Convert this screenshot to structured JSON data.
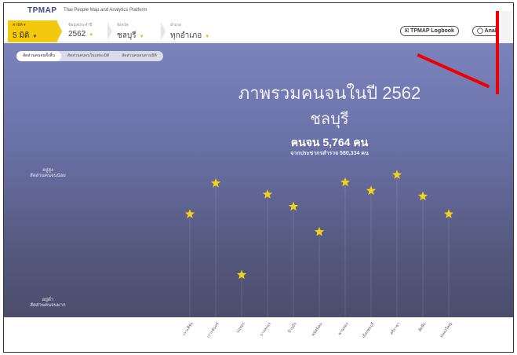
{
  "header": {
    "logo": "TPMAP",
    "logo_accent": "&",
    "tagline": "Thai People Map and Analytics Platform"
  },
  "filters": {
    "province_button": {
      "caption": "ค่ามิติ ▾",
      "value": "5 มิติ"
    },
    "year": {
      "caption": "ข้อมูลประจำปี",
      "value": "2562"
    },
    "province": {
      "caption": "จังหวัด",
      "value": "ชลบุรี"
    },
    "district": {
      "caption": "อำเภอ",
      "value": "ทุกอำเภอ"
    }
  },
  "buttons": {
    "logbook": "🗉 TPMAP Logbook",
    "analytics": "◯ Analy"
  },
  "tabs": [
    {
      "label": "สัดส่วนคนจนทั้งสิ้น",
      "active": true
    },
    {
      "label": "สัดส่วนคนจนในแต่ละมิติ",
      "active": false
    },
    {
      "label": "สัดส่วนคนจนตามมิติ",
      "active": false
    }
  ],
  "hero": {
    "line1": "ภาพรวมคนจนในปี 2562",
    "line2": "ชลบุรี",
    "line3": "คนจน 5,764 คน",
    "line4": "จากประชากรสำรวจ 580,334 คน"
  },
  "axis": {
    "top": "อยู่สูง\nสัดส่วนคนจนน้อย",
    "bottom": "อยู่ต่ำ\nสัดส่วนคนจนมาก"
  },
  "colors": {
    "star": "#f3d317",
    "accent": "#f2c90e",
    "annotation": "#ee0000"
  },
  "chart_data": {
    "type": "scatter",
    "categories": [
      "เกาะสีชัง",
      "เกาะจันทร์",
      "บ่อทอง",
      "บางละมุง",
      "บ้านบึง",
      "พนัสนิคม",
      "พานทอง",
      "เมืองชลบุรี",
      "ศรีราชา",
      "สัตหีบ",
      "หนองใหญ่"
    ],
    "values": [
      0.3,
      0.63,
      -0.35,
      0.51,
      0.38,
      0.11,
      0.64,
      0.55,
      0.72,
      0.49,
      0.3
    ]
  }
}
